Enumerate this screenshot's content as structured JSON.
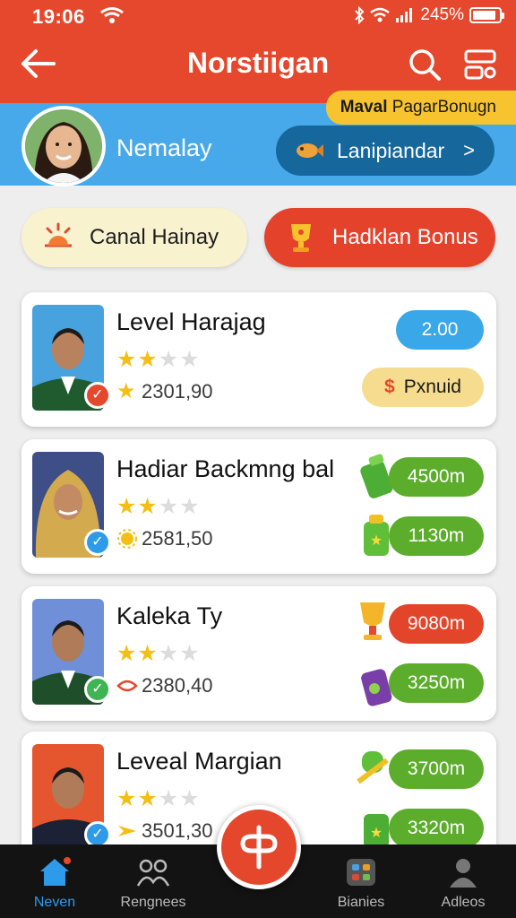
{
  "status_bar": {
    "time": "19:06",
    "battery": "245%",
    "battery_level": 0.9
  },
  "header": {
    "title": "Norstiigan"
  },
  "profile": {
    "name": "Nemalay",
    "tag_bold": "Maval",
    "tag_rest": "PagarBonugn",
    "cta_label": "Lanipiandar",
    "cta_chevron": ">"
  },
  "actions": {
    "left_label": "Canal Hainay",
    "right_label": "Hadklan Bonus"
  },
  "cards": [
    {
      "name": "Level Harajag",
      "stars": 2,
      "score": "2301,90",
      "chip1": "2.00",
      "chip2": "Pxnuid",
      "chip2_prefix": "$"
    },
    {
      "name": "Hadiar Backmng bal",
      "stars": 2,
      "score": "2581,50",
      "chip1": "4500m",
      "chip2": "1130m"
    },
    {
      "name": "Kaleka Ty",
      "stars": 2,
      "score": "2380,40",
      "chip1": "9080m",
      "chip2": "3250m"
    },
    {
      "name": "Leveal Margian",
      "stars": 2,
      "score": "3501,30",
      "chip1": "3700m",
      "chip2": "3320m"
    }
  ],
  "nav": [
    {
      "label": "Neven",
      "active": true
    },
    {
      "label": "Rengnees",
      "active": false
    },
    {
      "label": "Bianies",
      "active": false
    },
    {
      "label": "Adleos",
      "active": false
    }
  ],
  "colors": {
    "header": "#e5482c",
    "band": "#47a9ea",
    "accent_blue": "#3aa7e8",
    "green": "#5cad2c",
    "red": "#e3452a",
    "nav_bg": "#131313"
  },
  "icons": [
    "wifi-icon",
    "bluetooth-icon",
    "signal-icon",
    "battery-icon",
    "back-arrow-icon",
    "search-icon",
    "filter-icon",
    "fish-icon",
    "sun-icon",
    "trophy-icon",
    "star-icon",
    "home-icon",
    "group-icon",
    "grid-icon",
    "person-icon"
  ]
}
